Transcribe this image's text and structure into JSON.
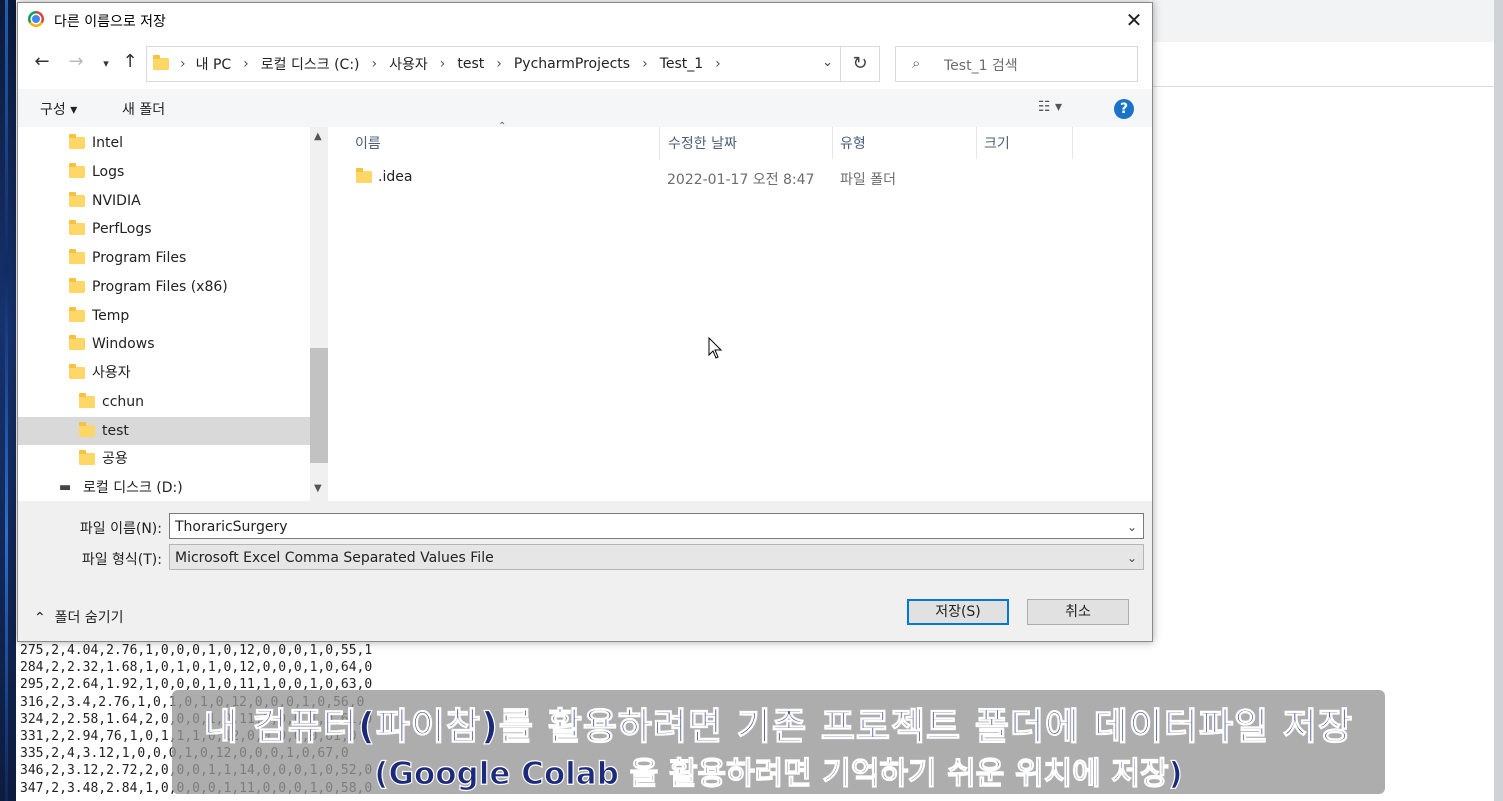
{
  "dialog": {
    "title": "다른 이름으로 저장",
    "close_icon": "✕"
  },
  "address": {
    "crumbs": [
      "내 PC",
      "로컬 디스크 (C:)",
      "사용자",
      "test",
      "PycharmProjects",
      "Test_1"
    ],
    "search_placeholder": "Test_1 검색"
  },
  "toolbar": {
    "organize": "구성 ▾",
    "new_folder": "새 폴더",
    "help": "?"
  },
  "tree": {
    "items": [
      {
        "label": "Intel"
      },
      {
        "label": "Logs"
      },
      {
        "label": "NVIDIA"
      },
      {
        "label": "PerfLogs"
      },
      {
        "label": "Program Files"
      },
      {
        "label": "Program Files (x86)"
      },
      {
        "label": "Temp"
      },
      {
        "label": "Windows"
      },
      {
        "label": "사용자"
      },
      {
        "label": "cchun"
      },
      {
        "label": "test",
        "selected": true
      },
      {
        "label": "공용"
      },
      {
        "label": "로컬 디스크 (D:)"
      }
    ]
  },
  "list": {
    "columns": [
      "이름",
      "수정한 날짜",
      "유형",
      "크기"
    ],
    "rows": [
      {
        "name": ".idea",
        "date": "2022-01-17 오전 8:47",
        "type": "파일 폴더",
        "size": ""
      }
    ]
  },
  "form": {
    "filename_label": "파일 이름(N):",
    "filename_value": "ThoraricSurgery",
    "filetype_label": "파일 형식(T):",
    "filetype_value": "Microsoft Excel Comma Separated Values File",
    "hide_folders": "폴더 숨기기",
    "save": "저장(S)",
    "cancel": "취소"
  },
  "background_csv": "275,2,4.04,2.76,1,0,0,0,1,0,12,0,0,0,1,0,55,1\n284,2,2.32,1.68,1,0,1,0,1,0,12,0,0,0,1,0,64,0\n295,2,2.64,1.92,1,0,0,0,1,0,11,1,0,0,1,0,63,0\n316,2,3.4,2.76,1,0,1,0,1,0,12,0,0,0,1,0,56,0\n324,2,2.58,1.64,2,0,0,0,1,0,11,0,0,0,1,0,61,0\n331,2,2.94,76,1,0,1,1,1,0,12,0,0,0,0,0,61,0\n335,2,4,3.12,1,0,0,0,1,0,12,0,0,0,1,0,67,0\n346,2,3.12,2.72,2,0,0,0,1,1,14,0,0,0,1,0,52,0\n347,2,3.48,2.84,1,0,0,0,0,1,11,0,0,0,1,0,58,0",
  "subtitle": {
    "line1": "내 컴퓨터(파이참)를 활용하려면 기존 프로젝트 폴더에 데이터파일 저장",
    "line2": "(Google Colab 을 활용하려면 기억하기 쉬운 위치에 저장)"
  }
}
